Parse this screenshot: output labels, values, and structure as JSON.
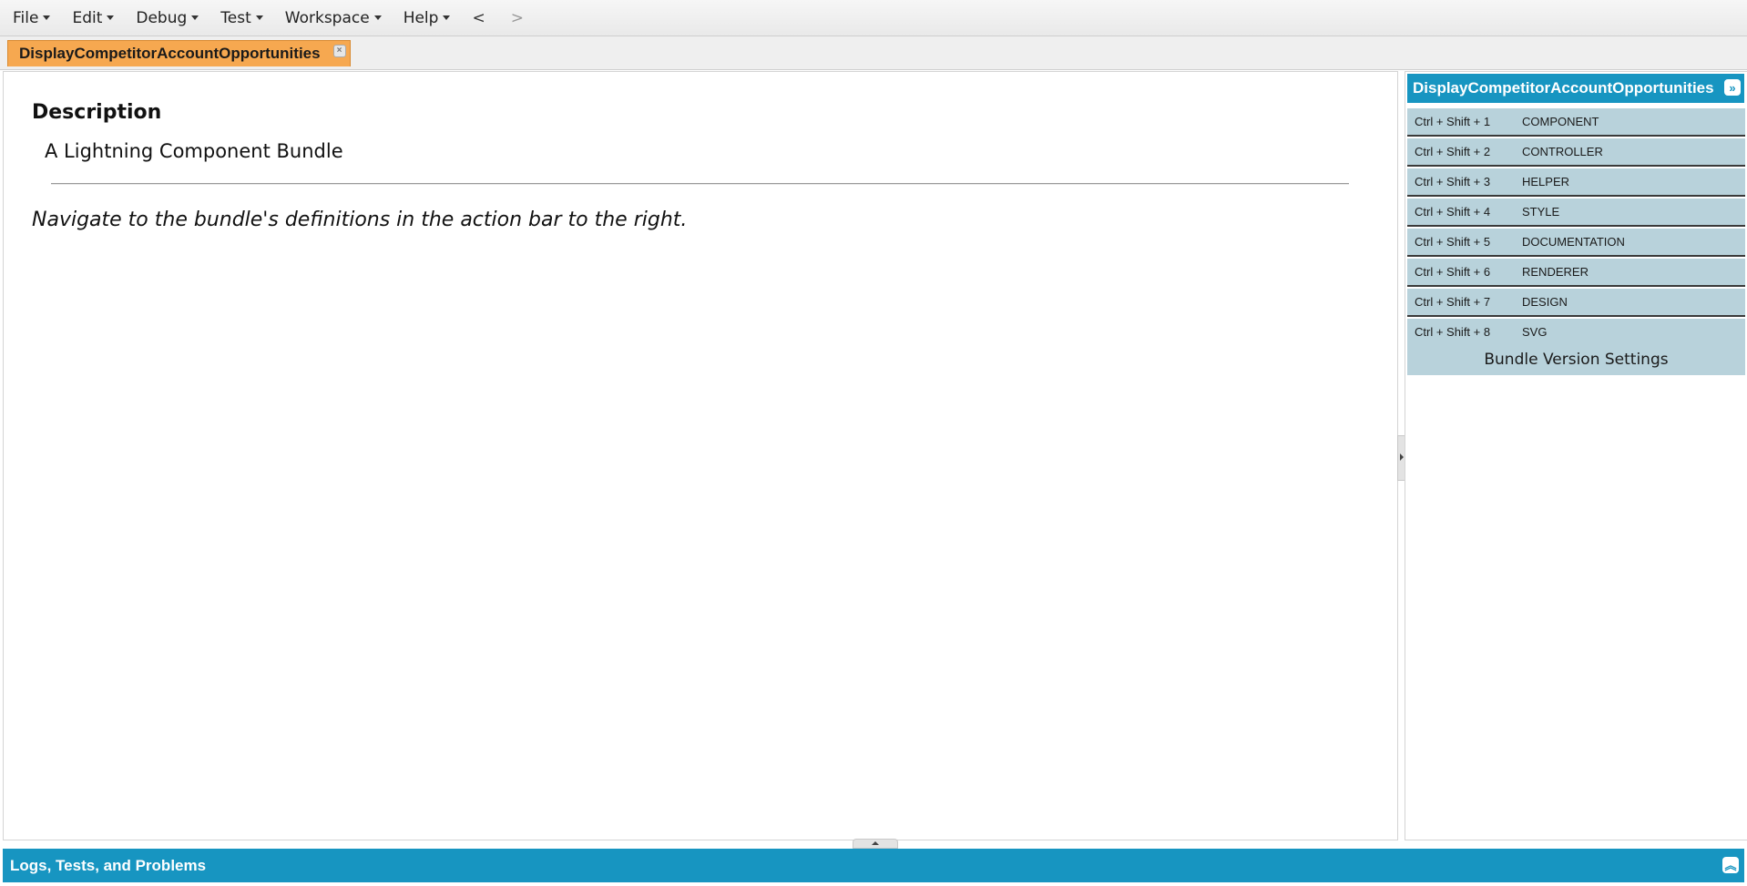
{
  "menubar": {
    "items": [
      {
        "label": "File"
      },
      {
        "label": "Edit"
      },
      {
        "label": "Debug"
      },
      {
        "label": "Test"
      },
      {
        "label": "Workspace"
      },
      {
        "label": "Help"
      }
    ],
    "back_label": "<",
    "forward_label": ">"
  },
  "tabs": [
    {
      "label": "DisplayCompetitorAccountOpportunities",
      "close_icon": "close-icon"
    }
  ],
  "content": {
    "title": "Description",
    "subtitle": "A Lightning Component Bundle",
    "hint": "Navigate to the bundle's definitions in the action bar to the right."
  },
  "right_panel": {
    "title": "DisplayCompetitorAccountOpportunities",
    "collapse_icon": "double-chevron-right-icon",
    "definitions": [
      {
        "shortcut": "Ctrl + Shift + 1",
        "name": "COMPONENT"
      },
      {
        "shortcut": "Ctrl + Shift + 2",
        "name": "CONTROLLER"
      },
      {
        "shortcut": "Ctrl + Shift + 3",
        "name": "HELPER"
      },
      {
        "shortcut": "Ctrl + Shift + 4",
        "name": "STYLE"
      },
      {
        "shortcut": "Ctrl + Shift + 5",
        "name": "DOCUMENTATION"
      },
      {
        "shortcut": "Ctrl + Shift + 6",
        "name": "RENDERER"
      },
      {
        "shortcut": "Ctrl + Shift + 7",
        "name": "DESIGN"
      },
      {
        "shortcut": "Ctrl + Shift + 8",
        "name": "SVG"
      }
    ],
    "bundle_settings_label": "Bundle Version Settings"
  },
  "bottom_panel": {
    "title": "Logs, Tests, and Problems",
    "expand_icon": "double-chevron-up-icon"
  },
  "colors": {
    "accent": "#1795c1",
    "tab_active": "#f6a850",
    "definition_row": "#b8d2db"
  }
}
